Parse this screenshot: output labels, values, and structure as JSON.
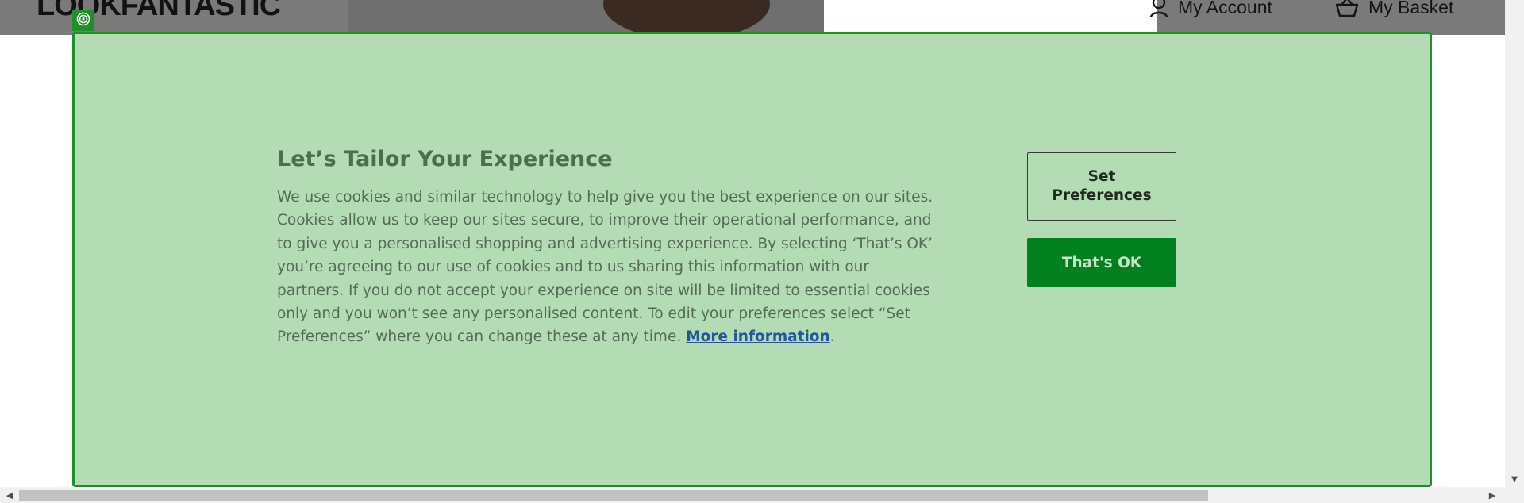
{
  "site": {
    "logo_text": "LOOKFANTASTIC",
    "account_label": "My Account",
    "basket_label": "My Basket",
    "icons": [
      "user-icon",
      "basket-icon"
    ]
  },
  "consent": {
    "title": "Let’s Tailor Your Experience",
    "body": "We use cookies and similar technology to help give you the best experience on our sites. Cookies allow us to keep our sites secure, to improve their operational performance, and to give you a personalised shopping and advertising experience. By selecting ‘That’s OK’ you’re agreeing to our use of cookies and to us sharing this information with our partners. If you do not accept your experience on site will be limited to essential cookies only and you won’t see any personalised content. To edit your preferences select “Set Preferences” where you can change these at any time.",
    "more_info_label": "More information",
    "more_info_suffix": ".",
    "set_preferences_label": "Set Preferences",
    "accept_label": "That's OK",
    "badge_icon": "target-icon",
    "colors": {
      "banner_bg": "#b4dcb4",
      "banner_border": "#1f8f2a",
      "accept_bg": "#00801f",
      "link": "#24559d"
    }
  },
  "scrollbar": {
    "left_arrow": "◀",
    "right_arrow": "▶",
    "down_arrow": "▼"
  }
}
